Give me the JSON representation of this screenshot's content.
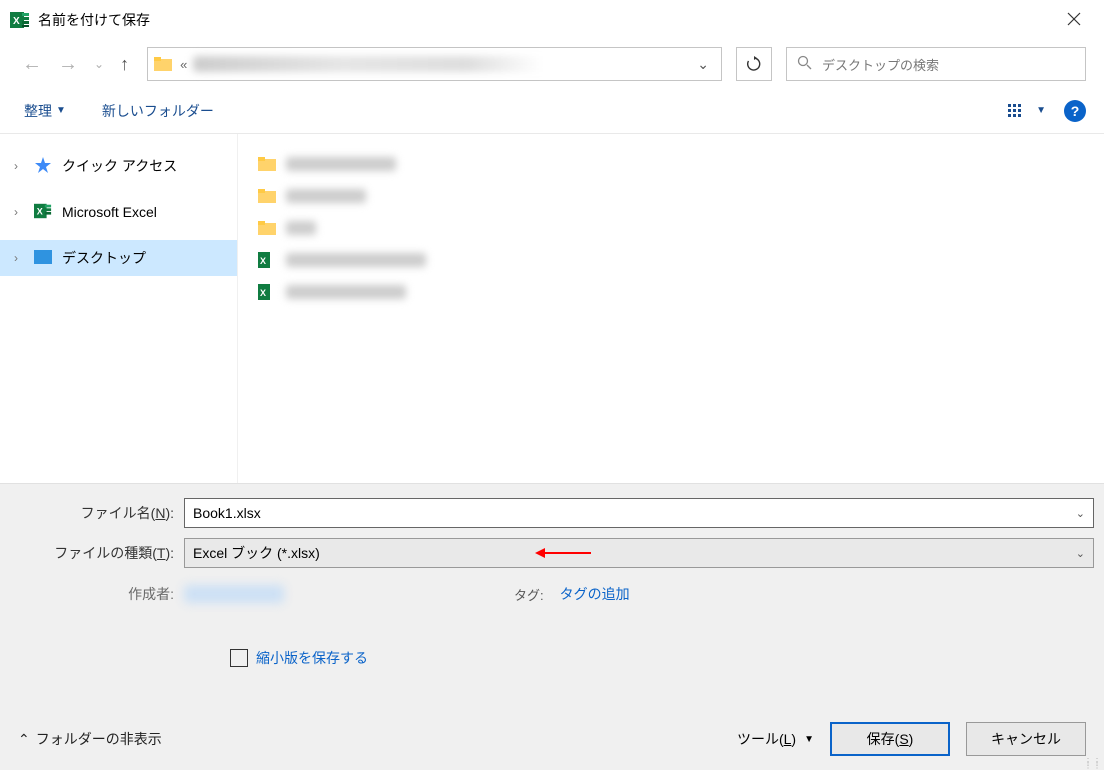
{
  "title": "名前を付けて保存",
  "search_placeholder": "デスクトップの検索",
  "toolbar": {
    "organize": "整理",
    "new_folder": "新しいフォルダー"
  },
  "sidebar": {
    "quick_access": "クイック アクセス",
    "excel": "Microsoft Excel",
    "desktop": "デスクトップ"
  },
  "form": {
    "filename_label": "ファイル名(N):",
    "filename_value": "Book1.xlsx",
    "filetype_label": "ファイルの種類(T):",
    "filetype_value": "Excel ブック (*.xlsx)",
    "author_label": "作成者:",
    "tag_label": "タグ:",
    "tag_link": "タグの追加",
    "thumbnail_label": "縮小版を保存する"
  },
  "footer": {
    "hide_folder": "フォルダーの非表示",
    "tools": "ツール(L)",
    "save": "保存(S)",
    "cancel": "キャンセル"
  }
}
